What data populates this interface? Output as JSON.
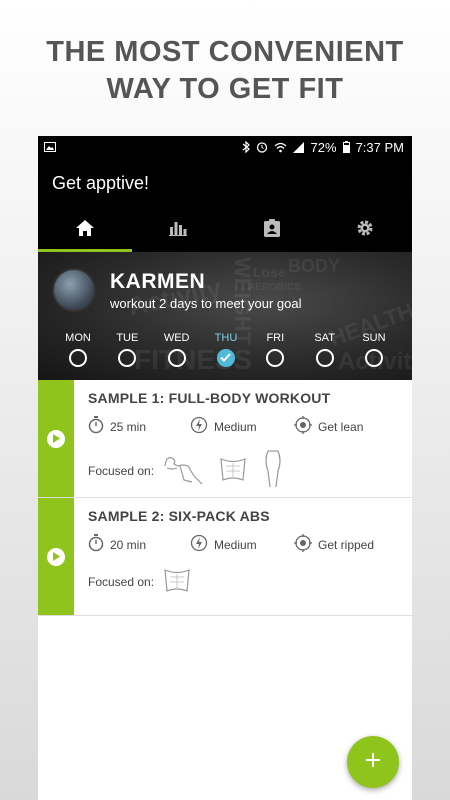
{
  "headline": {
    "line1": "THE MOST CONVENIENT",
    "line2": "WAY TO GET FIT"
  },
  "status_bar": {
    "battery": "72%",
    "time": "7:37 PM",
    "icons": [
      "image-icon",
      "bluetooth-icon",
      "alarm-icon",
      "wifi-icon",
      "signal-icon",
      "battery-icon"
    ]
  },
  "app_bar": {
    "title": "Get apptive!"
  },
  "tabs": [
    {
      "icon": "home-icon",
      "active": true
    },
    {
      "icon": "stats-icon",
      "active": false
    },
    {
      "icon": "profile-clipboard-icon",
      "active": false
    },
    {
      "icon": "settings-gear-icon",
      "active": false
    }
  ],
  "profile": {
    "name": "KARMEN",
    "subtitle": "workout 2 days to meet your goal",
    "background_words": [
      "Activity",
      "FITNESS",
      "WEIGHT",
      "BODY",
      "Lose",
      "AEROBICS",
      "HEALTH",
      "Activity"
    ],
    "days": [
      {
        "label": "MON",
        "done": false
      },
      {
        "label": "TUE",
        "done": false
      },
      {
        "label": "WED",
        "done": false
      },
      {
        "label": "THU",
        "done": true,
        "today": true
      },
      {
        "label": "FRI",
        "done": false
      },
      {
        "label": "SAT",
        "done": false
      },
      {
        "label": "SUN",
        "done": false
      }
    ]
  },
  "workouts": [
    {
      "title": "SAMPLE 1: FULL-BODY WORKOUT",
      "duration": "25 min",
      "intensity": "Medium",
      "goal": "Get lean",
      "focused_label": "Focused on:",
      "focus_areas": [
        "arms-icon",
        "abs-icon",
        "legs-icon"
      ]
    },
    {
      "title": "SAMPLE 2: SIX-PACK ABS",
      "duration": "20 min",
      "intensity": "Medium",
      "goal": "Get ripped",
      "focused_label": "Focused on:",
      "focus_areas": [
        "abs-icon"
      ]
    }
  ],
  "fab": {
    "label": "+"
  },
  "colors": {
    "accent": "#8fc41c",
    "today": "#4fb9d6"
  }
}
